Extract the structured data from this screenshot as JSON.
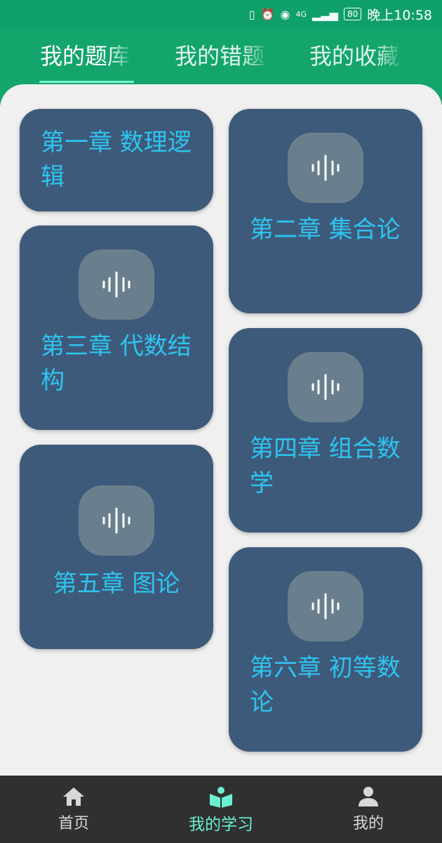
{
  "status_bar": {
    "network": "4G",
    "battery": "80",
    "time": "晚上10:58"
  },
  "tabs": [
    {
      "label": "我的题库",
      "active": true
    },
    {
      "label": "我的错题",
      "active": false
    },
    {
      "label": "我的收藏",
      "active": false
    }
  ],
  "chapters": [
    {
      "title": "第一章 数理逻辑",
      "icon": "audio-wave-icon"
    },
    {
      "title": "第二章 集合论",
      "icon": "audio-wave-icon"
    },
    {
      "title": "第三章 代数结构",
      "icon": "audio-wave-icon"
    },
    {
      "title": "第四章 组合数学",
      "icon": "audio-wave-icon"
    },
    {
      "title": "第五章 图论",
      "icon": "audio-wave-icon"
    },
    {
      "title": "第六章 初等数论",
      "icon": "audio-wave-icon"
    }
  ],
  "bottom_nav": [
    {
      "label": "首页",
      "icon": "home-icon",
      "active": false
    },
    {
      "label": "我的学习",
      "icon": "book-reader-icon",
      "active": true
    },
    {
      "label": "我的",
      "icon": "person-icon",
      "active": false
    }
  ],
  "colors": {
    "brand_green": "#13a56c",
    "card_bg": "#3e5a7b",
    "card_title": "#2ec4ef",
    "active_nav": "#6af0d2"
  }
}
